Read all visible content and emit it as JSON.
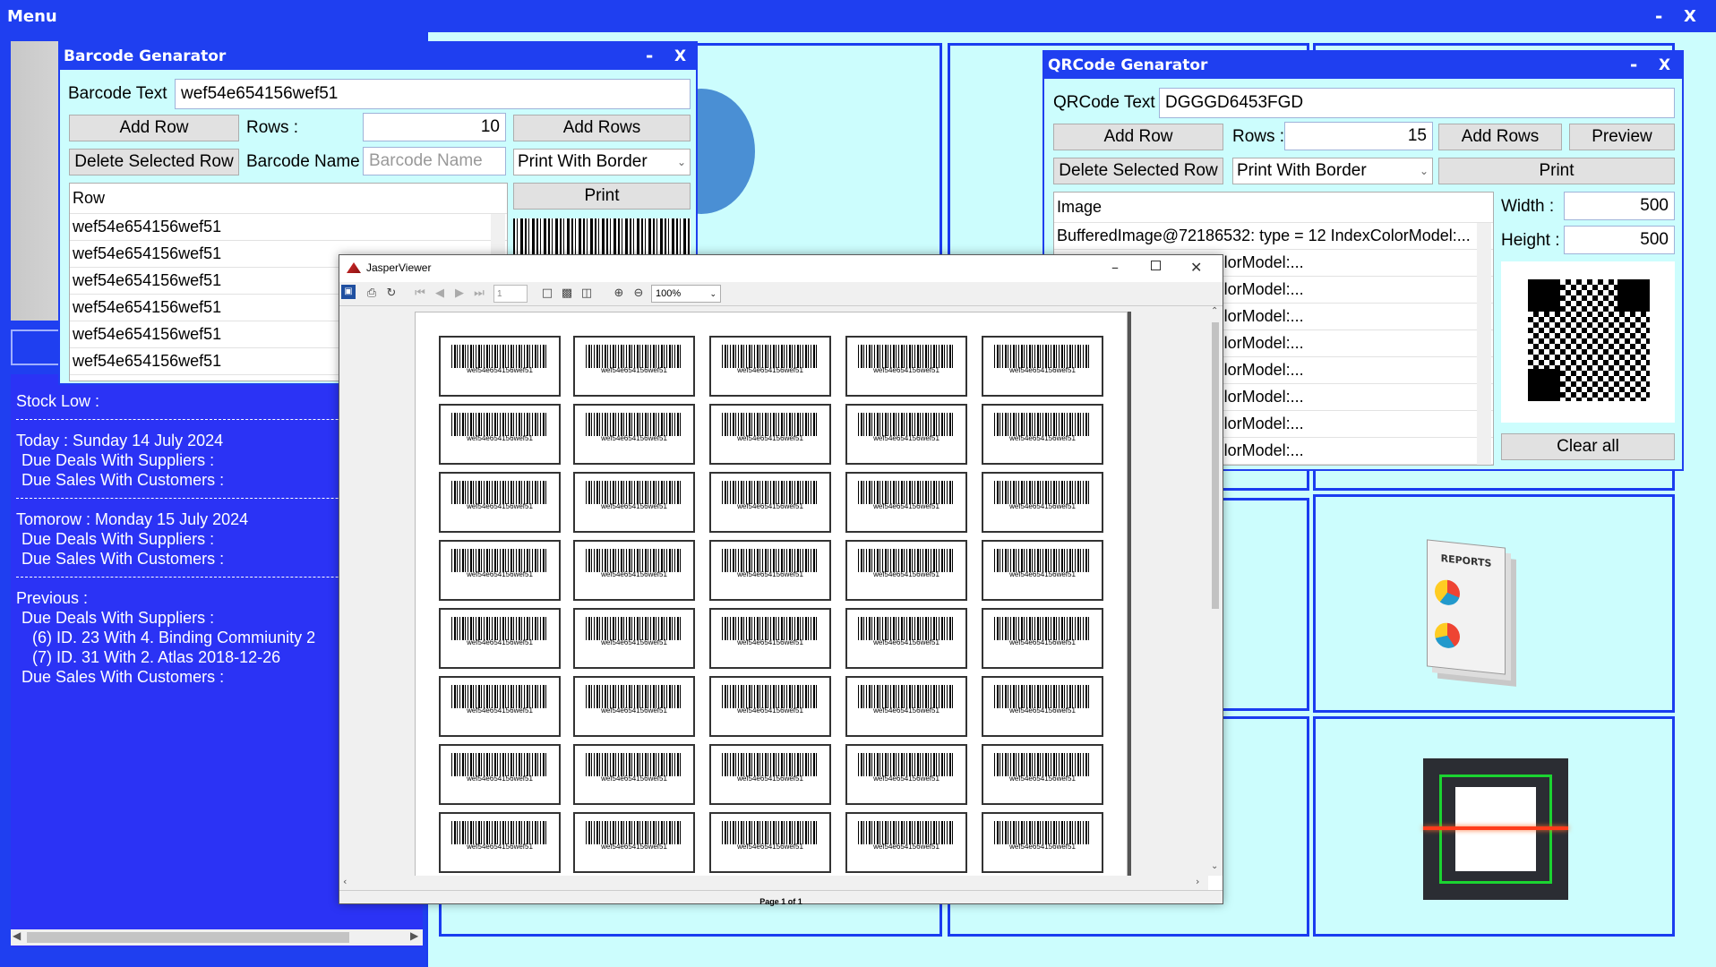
{
  "menu_window": {
    "title": "Menu",
    "min_label": "-",
    "close_label": "X"
  },
  "info_panel": {
    "stock_low": "Stock Low :",
    "today_line": "Today :  Sunday 14 July 2024",
    "today_suppliers": "Due Deals With Suppliers :",
    "today_customers": "Due Sales With Customers :",
    "tomorrow_line": "Tomorow :     Monday 15 July 2024",
    "tomorrow_suppliers": "Due Deals With Suppliers :",
    "tomorrow_customers": "Due Sales With Customers :",
    "previous_line": "Previous :",
    "previous_suppliers": "Due Deals With Suppliers :",
    "deal_1": "(6) ID. 23 With 4. Binding Commiunity    2",
    "deal_2": "(7) ID. 31 With 2. Atlas     2018-12-26",
    "previous_customers": "Due Sales With Customers :"
  },
  "barcode_window": {
    "title": "Barcode Genarator",
    "min_label": "-",
    "close_label": "X",
    "barcode_text_label": "Barcode Text",
    "barcode_text_value": "wef54e654156wef51",
    "add_row_label": "Add Row",
    "rows_label": "Rows :",
    "rows_value": "10",
    "add_rows_label": "Add Rows",
    "delete_row_label": "Delete Selected Row",
    "barcode_name_label": "Barcode Name :",
    "barcode_name_placeholder": "Barcode Name",
    "print_mode": "Print With Border",
    "print_label": "Print",
    "list_header": "Row",
    "rows": [
      "wef54e654156wef51",
      "wef54e654156wef51",
      "wef54e654156wef51",
      "wef54e654156wef51",
      "wef54e654156wef51",
      "wef54e654156wef51"
    ]
  },
  "qr_window": {
    "title": "QRCode Genarator",
    "min_label": "-",
    "close_label": "X",
    "qr_text_label": "QRCode Text",
    "qr_text_value": "DGGGD6453FGD",
    "add_row_label": "Add Row",
    "rows_label": "Rows :",
    "rows_value": "15",
    "add_rows_label": "Add Rows",
    "preview_label": "Preview",
    "delete_row_label": "Delete Selected Row",
    "print_mode": "Print With Border",
    "print_label": "Print",
    "list_header": "Image",
    "first_row": "BufferedImage@72186532: type = 12 IndexColorModel:...",
    "rows_partial": [
      "532: type = 12 IndexColorModel:...",
      "532: type = 12 IndexColorModel:...",
      "532: type = 12 IndexColorModel:...",
      "532: type = 12 IndexColorModel:...",
      "532: type = 12 IndexColorModel:...",
      "532: type = 12 IndexColorModel:...",
      "532: type = 12 IndexColorModel:...",
      "532: type = 12 IndexColorModel:..."
    ],
    "width_label": "Width :",
    "width_value": "500",
    "height_label": "Height :",
    "height_value": "500",
    "clear_label": "Clear all"
  },
  "jasper": {
    "title": "JasperViewer",
    "page_value": "1",
    "zoom_value": "100%",
    "status": "Page 1 of 1",
    "label_caption": "wef54e654156wef51"
  },
  "tiles": {
    "reports_caption": "REPORTS"
  },
  "colors": {
    "accent": "#1f3ff0",
    "panel": "#ccfdfd",
    "info_bg": "#2b33f5"
  }
}
